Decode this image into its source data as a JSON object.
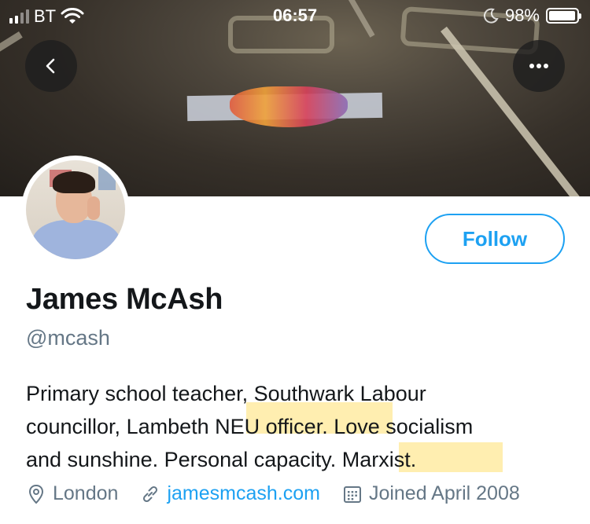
{
  "status_bar": {
    "carrier": "BT",
    "time": "06:57",
    "battery": "98%",
    "battery_level": 0.98,
    "signal_bars": 4,
    "signal_active": 2,
    "icons": [
      "signal-icon",
      "wifi-icon",
      "moon-icon",
      "battery-icon"
    ]
  },
  "header": {
    "back_icon": "chevron-left-icon",
    "more_icon": "more-horizontal-icon"
  },
  "profile": {
    "name": "James McAsh",
    "handle": "@mcash",
    "follow_label": "Follow",
    "bio_lines": [
      "Primary school teacher, Southwark Labour",
      "councillor, Lambeth NEU officer. Love socialism",
      "and sunshine. Personal capacity. Marxist."
    ],
    "location": "London",
    "website": "jamesmcash.com",
    "joined": "Joined April 2008"
  },
  "colors": {
    "accent": "#1da1f2",
    "secondary_text": "#657786",
    "primary_text": "#14171a",
    "highlight": "#ffe896"
  }
}
